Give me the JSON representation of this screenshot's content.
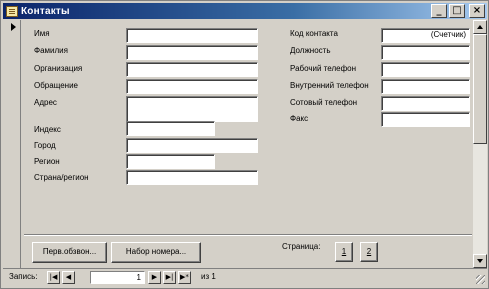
{
  "window": {
    "title": "Контакты",
    "controls": {
      "minimize": "_",
      "maximize": "□",
      "close": "×"
    }
  },
  "form": {
    "left_fields": [
      {
        "label": "Имя",
        "value": ""
      },
      {
        "label": "Фамилия",
        "value": ""
      },
      {
        "label": "Организация",
        "value": ""
      },
      {
        "label": "Обращение",
        "value": ""
      },
      {
        "label": "Адрес",
        "value": ""
      },
      {
        "label": "Индекс",
        "value": ""
      },
      {
        "label": "Город",
        "value": ""
      },
      {
        "label": "Регион",
        "value": ""
      },
      {
        "label": "Страна/регион",
        "value": ""
      }
    ],
    "right_fields": [
      {
        "label": "Код контакта",
        "value": "(Счетчик)"
      },
      {
        "label": "Должность",
        "value": ""
      },
      {
        "label": "Рабочий телефон",
        "value": ""
      },
      {
        "label": "Внутренний телефон",
        "value": ""
      },
      {
        "label": "Сотовый телефон",
        "value": ""
      },
      {
        "label": "Факс",
        "value": ""
      }
    ]
  },
  "footer": {
    "first_call_button": "Перв.обзвон...",
    "quick_dial_button": "Набор номера...",
    "page_label": "Страница:",
    "page_buttons": [
      "1",
      "2"
    ]
  },
  "navigation": {
    "record_label": "Запись:",
    "record_number": "1",
    "of_total": "из 1",
    "icons": [
      "first-record-icon",
      "prev-record-icon",
      "next-record-icon",
      "last-record-icon",
      "new-record-icon"
    ]
  },
  "colors": {
    "titlebar_start": "#0a246a",
    "titlebar_end": "#a6caf0",
    "face": "#d4d0c8"
  }
}
